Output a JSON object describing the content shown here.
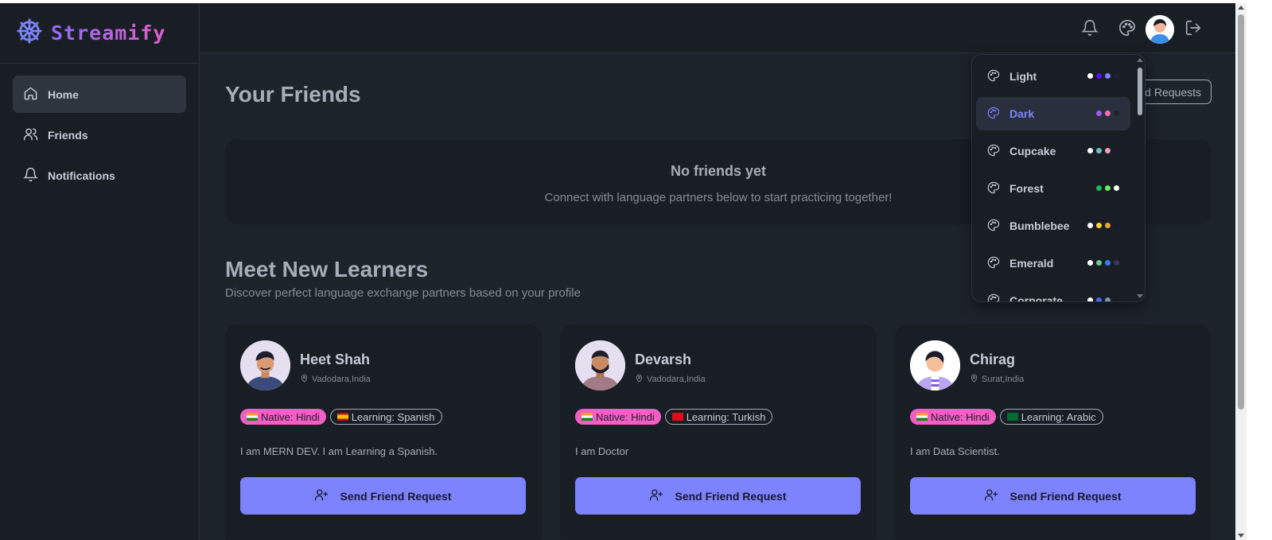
{
  "brand": {
    "name": "Streamify",
    "icon": "ship-wheel-icon"
  },
  "sidebar": {
    "items": [
      {
        "label": "Home",
        "icon": "home-icon",
        "active": true
      },
      {
        "label": "Friends",
        "icon": "users-icon",
        "active": false
      },
      {
        "label": "Notifications",
        "icon": "bell-icon",
        "active": false
      }
    ]
  },
  "topbar": {
    "icons": [
      "bell-icon",
      "palette-icon",
      "avatar",
      "logout-icon"
    ]
  },
  "friends_section": {
    "title": "Your Friends",
    "requests_button": "Friend Requests",
    "empty_title": "No friends yet",
    "empty_subtitle": "Connect with language partners below to start practicing together!"
  },
  "learners_section": {
    "title": "Meet New Learners",
    "subtitle": "Discover perfect language exchange partners based on your profile"
  },
  "learners": [
    {
      "name": "Heet Shah",
      "location": "Vadodara,India",
      "native": "Native: Hindi",
      "learning": "Learning: Spanish",
      "bio": "I am MERN DEV. I am Learning a Spanish.",
      "button": "Send Friend Request"
    },
    {
      "name": "Devarsh",
      "location": "Vadodara,India",
      "native": "Native: Hindi",
      "learning": "Learning: Turkish",
      "bio": "I am Doctor",
      "button": "Send Friend Request"
    },
    {
      "name": "Chirag",
      "location": "Surat,India",
      "native": "Native: Hindi",
      "learning": "Learning: Arabic",
      "bio": "I am Data Scientist.",
      "button": "Send Friend Request"
    }
  ],
  "theme_dropdown": {
    "themes": [
      {
        "label": "Light",
        "colors": [
          "#ffffff",
          "#570df8",
          "#f000b8",
          "#1d232a"
        ],
        "active": false
      },
      {
        "label": "Dark",
        "colors": [
          "#9f59f3",
          "#f471b5",
          "#1d232a"
        ],
        "active": true
      },
      {
        "label": "Cupcake",
        "colors": [
          "#ffffff",
          "#65c3c8",
          "#ef9fbc",
          "#291334"
        ],
        "active": false
      },
      {
        "label": "Forest",
        "colors": [
          "#1eb854",
          "#6ae86a",
          "#ffffff"
        ],
        "active": false
      },
      {
        "label": "Bumblebee",
        "colors": [
          "#ffffff",
          "#f9d72f",
          "#e0a82e",
          "#181830"
        ],
        "active": false
      },
      {
        "label": "Emerald",
        "colors": [
          "#ffffff",
          "#66cc8a",
          "#377cfb",
          "#333c4d"
        ],
        "active": false
      },
      {
        "label": "Corporate",
        "colors": [
          "#ffffff",
          "#4b6bfb",
          "#7b92b2",
          "#181a2a"
        ],
        "active": false
      }
    ]
  },
  "colors": {
    "background": "#1d232a",
    "surface": "#191e24",
    "primary": "#7c83fd",
    "native_badge": "#ef5fc5"
  }
}
